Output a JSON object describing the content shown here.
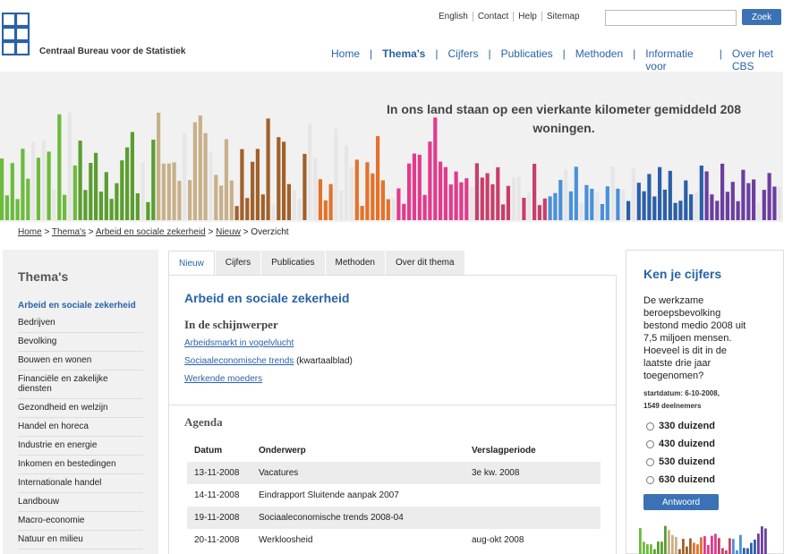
{
  "header": {
    "organization": "Centraal Bureau voor de Statistiek",
    "logo_text": "cbs",
    "utility_links": [
      "English",
      "Contact",
      "Help",
      "Sitemap"
    ],
    "search": {
      "placeholder": "",
      "value": "",
      "button_label": "Zoek"
    },
    "nav": [
      {
        "label": "Home",
        "active": false
      },
      {
        "label": "Thema's",
        "active": true
      },
      {
        "label": "Cijfers",
        "active": false
      },
      {
        "label": "Publicaties",
        "active": false
      },
      {
        "label": "Methoden",
        "active": false
      },
      {
        "label": "Informatie voor",
        "active": false
      },
      {
        "label": "Over het CBS",
        "active": false
      }
    ],
    "nav_separator": "|",
    "accent_color": "#2a62a8"
  },
  "banner": {
    "text": "In ons land staan op een vierkante kilometer gemiddeld 208 woningen.",
    "colors": [
      "#6cbb3c",
      "#5a9e2f",
      "#c8b08a",
      "#a0612a",
      "#e4722a",
      "#e23a8c",
      "#c83f6a",
      "#4a90d9",
      "#2b5fa8",
      "#6b3ea0"
    ]
  },
  "breadcrumb": {
    "items": [
      "Home",
      "Thema's",
      "Arbeid en sociale zekerheid",
      "Nieuw",
      "Overzicht"
    ],
    "separator": ">"
  },
  "sidebar": {
    "title": "Thema's",
    "items": [
      {
        "label": "Arbeid en sociale zekerheid",
        "active": true
      },
      {
        "label": "Bedrijven",
        "active": false
      },
      {
        "label": "Bevolking",
        "active": false
      },
      {
        "label": "Bouwen en wonen",
        "active": false
      },
      {
        "label": "Financiële en zakelijke diensten",
        "active": false
      },
      {
        "label": "Gezondheid en welzijn",
        "active": false
      },
      {
        "label": "Handel en horeca",
        "active": false
      },
      {
        "label": "Industrie en energie",
        "active": false
      },
      {
        "label": "Inkomen en bestedingen",
        "active": false
      },
      {
        "label": "Internationale handel",
        "active": false
      },
      {
        "label": "Landbouw",
        "active": false
      },
      {
        "label": "Macro-economie",
        "active": false
      },
      {
        "label": "Natuur en milieu",
        "active": false
      }
    ]
  },
  "tabs": [
    {
      "label": "Nieuw",
      "active": true
    },
    {
      "label": "Cijfers",
      "active": false
    },
    {
      "label": "Publicaties",
      "active": false
    },
    {
      "label": "Methoden",
      "active": false
    },
    {
      "label": "Over dit thema",
      "active": false
    }
  ],
  "main": {
    "title": "Arbeid en sociale zekerheid",
    "spotlight_title": "In de schijnwerper",
    "spotlight_links": [
      {
        "link": "Arbeidsmarkt in vogelvlucht",
        "suffix": ""
      },
      {
        "link": "Sociaaleconomische trends",
        "suffix": " (kwartaalblad)"
      },
      {
        "link": "Werkende moeders",
        "suffix": ""
      }
    ]
  },
  "agenda": {
    "title": "Agenda",
    "columns": [
      "Datum",
      "Onderwerp",
      "Verslagperiode"
    ],
    "rows": [
      [
        "13-11-2008",
        "Vacatures",
        "3e kw. 2008"
      ],
      [
        "14-11-2008",
        "Eindrapport Sluitende aanpak 2007",
        ""
      ],
      [
        "19-11-2008",
        "Sociaaleconomische trends 2008-04",
        ""
      ],
      [
        "20-11-2008",
        "Werkloosheid",
        "aug-okt 2008"
      ]
    ]
  },
  "quiz": {
    "title": "Ken je cijfers",
    "question": "De werkzame beroepsbevolking bestond medio 2008 uit 7,5 miljoen mensen. Hoeveel is dit in de laatste drie jaar toegenomen?",
    "meta_line1": "startdatum: 6-10-2008,",
    "meta_line2": "1549 deelnemers",
    "options": [
      "330 duizend",
      "430 duizend",
      "530 duizend",
      "630 duizend"
    ],
    "button_label": "Antwoord"
  }
}
